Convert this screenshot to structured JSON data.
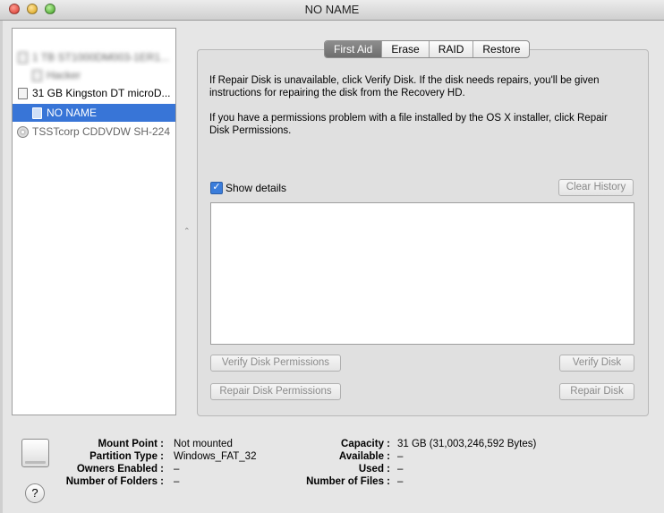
{
  "window": {
    "title": "NO NAME"
  },
  "sidebar": {
    "items": [
      {
        "label": "1 TB ST1000DM003-1ER1..."
      },
      {
        "label": "Hacker"
      },
      {
        "label": "31 GB Kingston DT microD..."
      },
      {
        "label": "NO NAME"
      },
      {
        "label": "TSSTcorp CDDVDW SH-224"
      }
    ]
  },
  "tabs": [
    "First Aid",
    "Erase",
    "RAID",
    "Restore"
  ],
  "first_aid": {
    "info1_line1": "If Repair Disk is unavailable, click Verify Disk. If the disk needs repairs, you'll be given",
    "info1_line2": "instructions for repairing the disk from the Recovery HD.",
    "info2_line1": "If you have a permissions problem with a file installed by the OS X installer, click Repair",
    "info2_line2": "Disk Permissions.",
    "show_details": "Show details",
    "clear_history": "Clear History",
    "verify_permissions": "Verify Disk Permissions",
    "repair_permissions": "Repair Disk Permissions",
    "verify_disk": "Verify Disk",
    "repair_disk": "Repair Disk"
  },
  "disk_info": {
    "mount_point_label": "Mount Point :",
    "mount_point": "Not mounted",
    "partition_type_label": "Partition Type :",
    "partition_type": "Windows_FAT_32",
    "owners_enabled_label": "Owners Enabled :",
    "owners_enabled": "–",
    "folders_label": "Number of Folders :",
    "folders": "–",
    "capacity_label": "Capacity :",
    "capacity": "31 GB (31,003,246,592 Bytes)",
    "available_label": "Available :",
    "available": "–",
    "used_label": "Used :",
    "used": "–",
    "files_label": "Number of Files :",
    "files": "–"
  },
  "help": "?",
  "icons": {
    "checkbox": "checkmark-icon",
    "resize": "resize-handle-icon"
  }
}
